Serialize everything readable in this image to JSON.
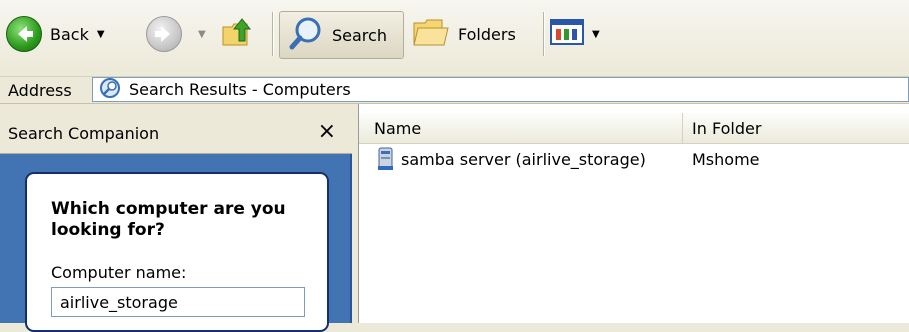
{
  "toolbar": {
    "back_label": "Back",
    "search_label": "Search",
    "folders_label": "Folders",
    "icons": [
      "back-arrow-icon",
      "forward-arrow-icon",
      "up-folder-icon",
      "search-magnifier-icon",
      "folders-icon",
      "views-icon"
    ]
  },
  "address": {
    "label": "Address",
    "value": "Search Results - Computers"
  },
  "search_companion": {
    "title": "Search Companion",
    "close_label": "×",
    "question": "Which computer are you looking for?",
    "computer_name_label": "Computer name:",
    "computer_name_value": "airlive_storage"
  },
  "results": {
    "columns": [
      "Name",
      "In Folder"
    ],
    "rows": [
      {
        "name": "samba server (airlive_storage)",
        "in_folder": "Mshome",
        "icon": "network-computer-icon"
      }
    ]
  },
  "colors": {
    "chrome": "#ece9d8",
    "companion_blue": "#4274b4",
    "field_border": "#7f9db9"
  }
}
